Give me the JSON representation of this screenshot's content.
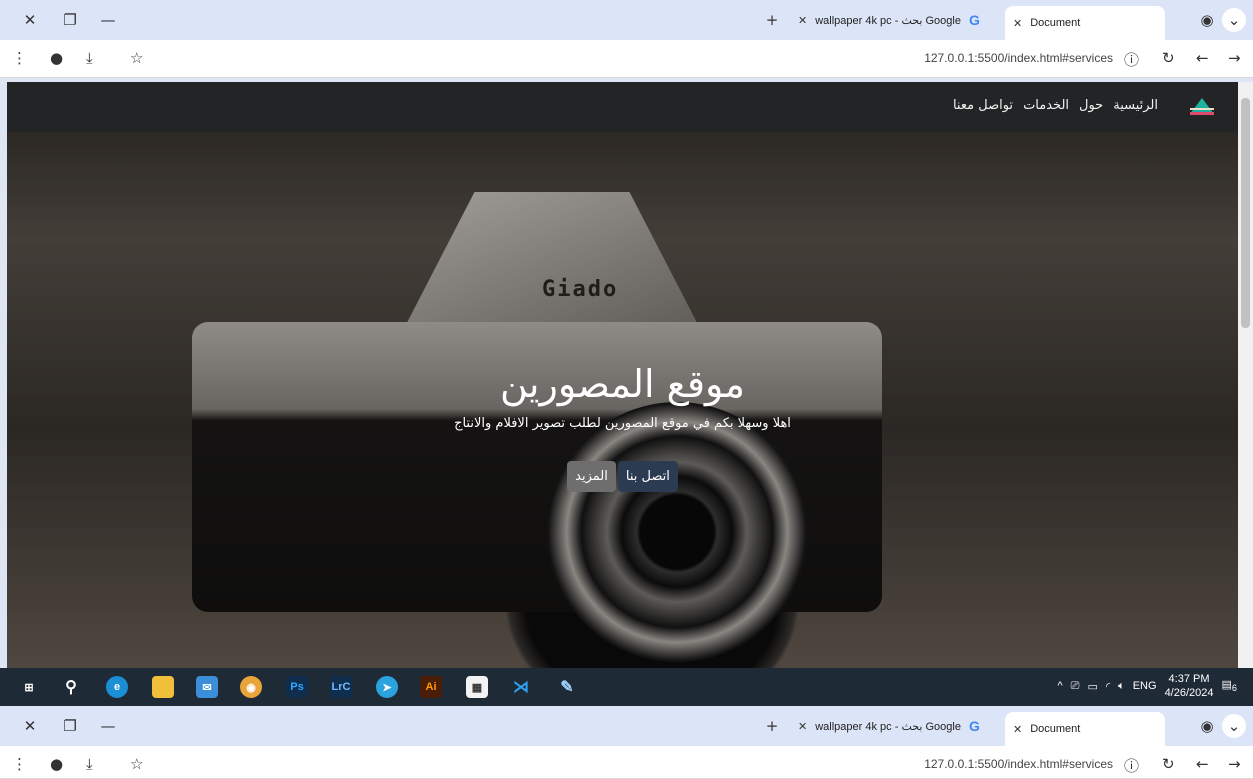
{
  "browser": {
    "tabs": [
      {
        "title": "wallpaper 4k pc - بحث Google",
        "active": false
      },
      {
        "title": "Document",
        "active": true
      }
    ],
    "new_tab": "+",
    "url": "127.0.0.1:5500/index.html#services"
  },
  "site": {
    "nav": [
      "الرئيسية",
      "حول",
      "الخدمات",
      "تواصل معنا"
    ],
    "hero": {
      "title": "موقع المصورين",
      "subtitle": "اهلا وسهلا بكم في موقع المصورين لطلب تصوير الافلام والانتاج",
      "btn_contact": "اتصل بنا",
      "btn_more": "المزيد"
    },
    "camera_brand": "Giado"
  },
  "taskbar": {
    "apps": [
      "start",
      "search",
      "edge",
      "files",
      "mail",
      "chrome",
      "photoshop",
      "lightroom",
      "telegram",
      "illustrator",
      "store",
      "vscode",
      "paint"
    ],
    "tray": {
      "lang": "ENG",
      "time": "4:37 PM",
      "date": "4/26/2024",
      "notifications": "6"
    }
  },
  "colors": {
    "navbar": "#222426",
    "contact_btn": "#2b3c52",
    "more_btn": "#6e6e6e",
    "taskbar": "#1f2a37"
  }
}
